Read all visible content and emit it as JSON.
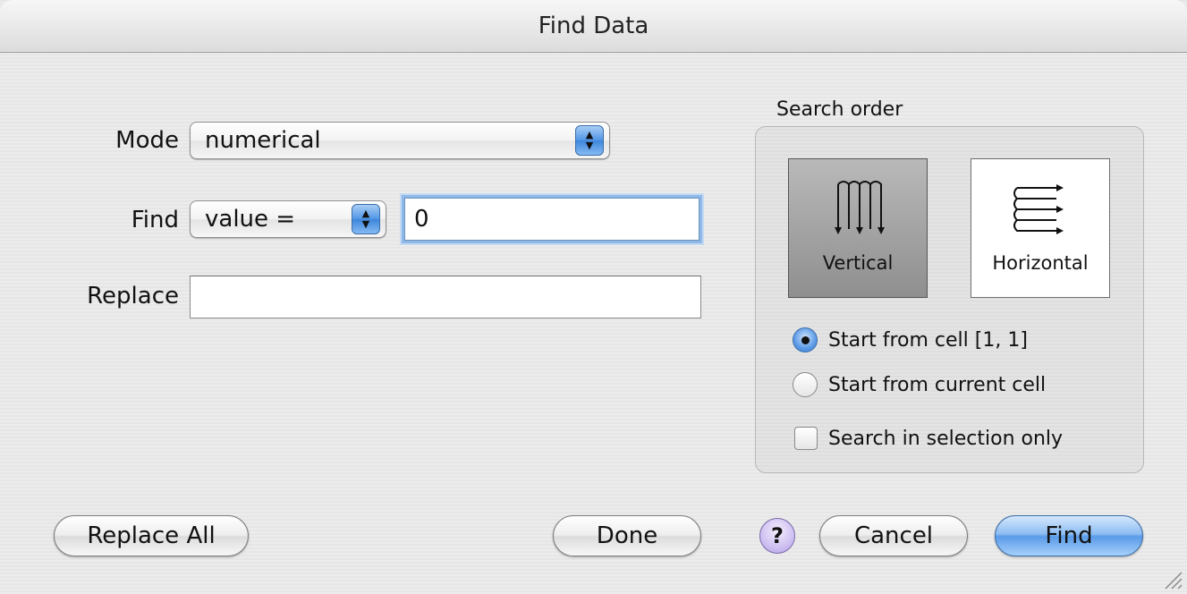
{
  "window": {
    "title": "Find Data"
  },
  "form": {
    "mode_label": "Mode",
    "mode_value": "numerical",
    "find_label": "Find",
    "find_op_value": "value =",
    "find_value": "0",
    "replace_label": "Replace",
    "replace_value": ""
  },
  "search_order": {
    "group_label": "Search order",
    "vertical_label": "Vertical",
    "horizontal_label": "Horizontal",
    "selected": "Vertical",
    "radio_start_cell": "Start from cell [1, 1]",
    "radio_current_cell": "Start from current cell",
    "radio_selected": "Start from cell [1, 1]",
    "checkbox_selection_only": "Search in selection only",
    "checkbox_checked": false
  },
  "buttons": {
    "replace_all": "Replace All",
    "done": "Done",
    "help": "?",
    "cancel": "Cancel",
    "find": "Find"
  },
  "icons": {
    "popup_arrows": "updown-arrows-icon",
    "vertical_order": "vertical-zigzag-icon",
    "horizontal_order": "horizontal-zigzag-icon",
    "resize": "resize-grip-icon"
  },
  "colors": {
    "accent": "#5a9be8",
    "focus_ring": "#8fb8e6",
    "selected_segment": "#8f8f8f"
  }
}
